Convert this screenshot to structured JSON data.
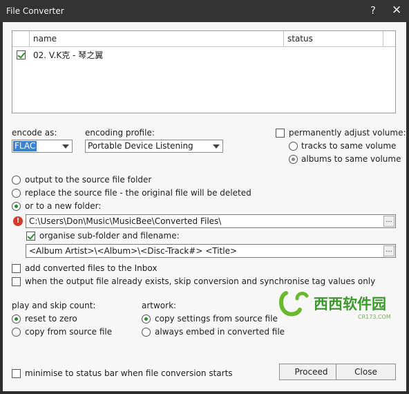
{
  "window": {
    "title": "File Converter",
    "help_glyph": "?",
    "close_glyph": "✕"
  },
  "list": {
    "columns": [
      "name",
      "status"
    ],
    "rows": [
      {
        "checked": true,
        "name": "02. V.K克 - 琴之翼",
        "status": ""
      }
    ]
  },
  "encode": {
    "encode_as_label": "encode as:",
    "encode_as_value": "FLAC",
    "profile_label": "encoding profile:",
    "profile_value": "Portable Device Listening"
  },
  "volume": {
    "adjust_label": "permanently adjust volume:",
    "adjust_checked": false,
    "tracks_label": "tracks to same volume",
    "albums_label": "albums to same volume",
    "selected": "albums"
  },
  "output": {
    "source_folder_label": "output to the source file folder",
    "replace_label": "replace the source file  - the original file will be deleted",
    "new_folder_label": "or to a new folder:",
    "selected": "new_folder",
    "folder_path": "C:\\Users\\Don\\Music\\MusicBee\\Converted Files\\",
    "browse_label": "...",
    "organise_label": "organise sub-folder and filename:",
    "organise_checked": true,
    "template": "<Album Artist>\\<Album>\\<Disc-Track#> <Title>"
  },
  "options": {
    "add_inbox_label": "add converted files to the Inbox",
    "add_inbox_checked": false,
    "skip_existing_label": "when the output file already exists, skip conversion and synchronise tag values only",
    "skip_existing_checked": false
  },
  "play_skip": {
    "label": "play and skip count:",
    "reset_label": "reset to zero",
    "copy_label": "copy from source file",
    "selected": "reset"
  },
  "artwork": {
    "label": "artwork:",
    "copy_label": "copy settings from source file",
    "embed_label": "always embed in converted file",
    "selected": "copy"
  },
  "footer": {
    "minimise_label": "minimise to status bar when file conversion starts",
    "minimise_checked": false,
    "proceed_label": "Proceed",
    "close_label": "Close"
  },
  "watermark": {
    "text_cn": "西西软件园",
    "text_en": "CR173.COM"
  },
  "colors": {
    "accent_green": "#2e8b2e",
    "selection_blue": "#3a82d6",
    "warning_red": "#d23a2a"
  }
}
